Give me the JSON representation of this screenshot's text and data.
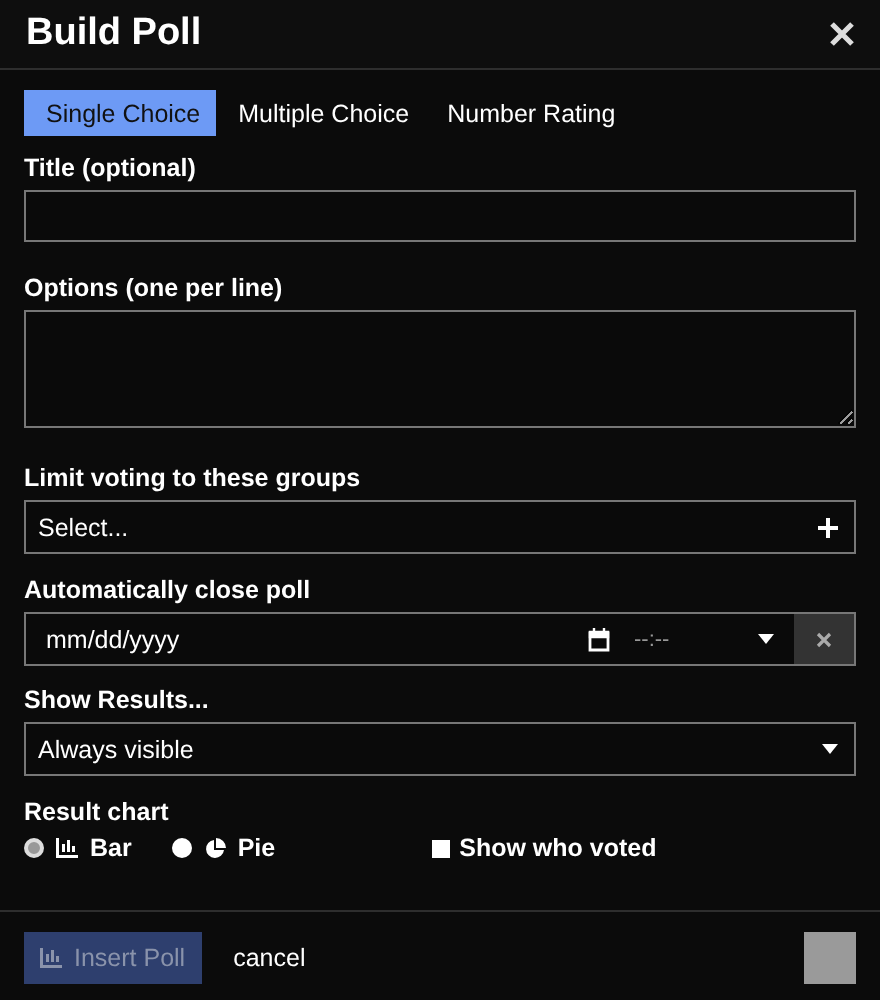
{
  "dialog": {
    "title": "Build Poll"
  },
  "tabs": [
    {
      "label": "Single Choice",
      "selected": true
    },
    {
      "label": "Multiple Choice",
      "selected": false
    },
    {
      "label": "Number Rating",
      "selected": false
    }
  ],
  "title_field": {
    "label": "Title (optional)"
  },
  "options_field": {
    "label": "Options (one per line)"
  },
  "groups_field": {
    "label": "Limit voting to these groups",
    "value": "Select..."
  },
  "close_field": {
    "label": "Automatically close poll",
    "date_placeholder": "mm/dd/yyyy",
    "time_placeholder": "--:--"
  },
  "results_field": {
    "label": "Show Results...",
    "value": "Always visible"
  },
  "result_chart": {
    "label": "Result chart",
    "choices": [
      {
        "label": "Bar",
        "kind": "bar",
        "selected": true
      },
      {
        "label": "Pie",
        "kind": "pie",
        "selected": false
      }
    ],
    "show_voters": {
      "label": "Show who voted",
      "checked": false
    }
  },
  "footer": {
    "insert_button": {
      "label": "Insert Poll",
      "disabled": true
    },
    "cancel": "cancel"
  }
}
